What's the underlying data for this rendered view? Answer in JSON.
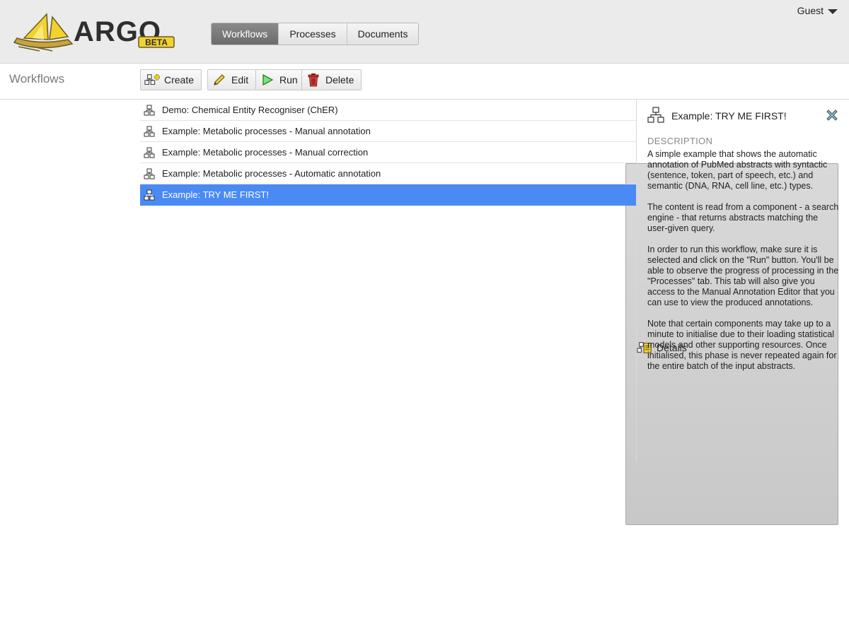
{
  "header": {
    "logo": {
      "text": "ARGO",
      "badge": "BETA"
    },
    "nav_tabs": [
      {
        "label": "Workflows",
        "active": true
      },
      {
        "label": "Processes",
        "active": false
      },
      {
        "label": "Documents",
        "active": false
      }
    ],
    "user_label": "Guest"
  },
  "toolbar": {
    "section_title": "Workflows",
    "create_label": "Create",
    "edit_label": "Edit",
    "run_label": "Run",
    "delete_label": "Delete",
    "details_label": "Details"
  },
  "workflows": [
    {
      "name": "Demo: Chemical Entity Recogniser (ChER)",
      "selected": false
    },
    {
      "name": "Example: Metabolic processes - Manual annotation",
      "selected": false
    },
    {
      "name": "Example: Metabolic processes - Manual correction",
      "selected": false
    },
    {
      "name": "Example: Metabolic processes - Automatic annotation",
      "selected": false
    },
    {
      "name": "Example: TRY ME FIRST!",
      "selected": true
    }
  ],
  "details": {
    "title": "Example: TRY ME FIRST!",
    "description_label": "DESCRIPTION",
    "paragraphs": [
      "A simple example that shows the automatic annotation of PubMed abstracts with syntactic (sentence, token, part of speech, etc.) and semantic (DNA, RNA, cell line, etc.) types.",
      "The content is read from a component - a search engine - that returns abstracts matching the user-given query.",
      "In order to run this workflow, make sure it is selected and click on the \"Run\" button. You'll be able to observe the progress of processing in the \"Processes\" tab. This tab will also give you access to the Manual Annotation Editor that you can use to view the produced annotations.",
      "Note that certain components may take up to a minute to initialise due to their loading statistical models and other supporting resources. Once initialised, this phase is never repeated again for the entire batch of the input abstracts."
    ]
  },
  "colors": {
    "header_bg": "#ebebeb",
    "selected_row": "#4a8af4",
    "active_tab": "#777777",
    "logo_yellow": "#f2d22e"
  },
  "icons": {
    "workflow": "workflow-tree-icon",
    "create": "create-workflow-icon",
    "edit": "pencil-icon",
    "run": "play-icon",
    "delete": "trash-icon",
    "details": "details-icon",
    "close": "close-icon",
    "user_menu": "caret-down-icon"
  }
}
